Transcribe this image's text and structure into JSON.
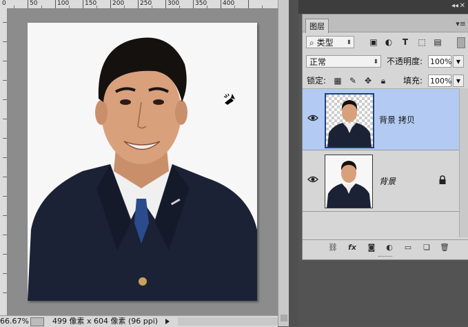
{
  "ruler": {
    "top_labels": [
      "0",
      "50",
      "100",
      "150",
      "200",
      "250",
      "300",
      "350",
      "400"
    ]
  },
  "status": {
    "zoom": "66.67%",
    "doc_info": "499 像素 x 604 像素 (96 ppi)"
  },
  "layers_panel": {
    "tab_label": "图层",
    "collapse_glyph": "◂◂",
    "close_glyph": "✕",
    "menu_glyph": "▾≡",
    "filter_type": "类型",
    "filter_icons": [
      "image-filter-icon",
      "adjustment-filter-icon",
      "type-filter-icon",
      "shape-filter-icon",
      "smart-object-filter-icon"
    ],
    "blend_mode": "正常",
    "opacity_label": "不透明度:",
    "opacity_value": "100%",
    "lock_label": "锁定:",
    "fill_label": "填充:",
    "fill_value": "100%",
    "layers": [
      {
        "name": "背景 拷贝",
        "visible": true,
        "selected": true,
        "locked": false
      },
      {
        "name": "背景",
        "visible": true,
        "selected": false,
        "locked": true
      }
    ],
    "bottom_icons": [
      "link-layers-icon",
      "fx-icon",
      "add-mask-icon",
      "adjustment-layer-icon",
      "group-folder-icon",
      "new-layer-icon",
      "trash-icon"
    ],
    "fx_label": "fx"
  },
  "colors": {
    "selection": "#b3cbf2",
    "jacket": "#1b2235",
    "skin": "#d9a07c"
  }
}
